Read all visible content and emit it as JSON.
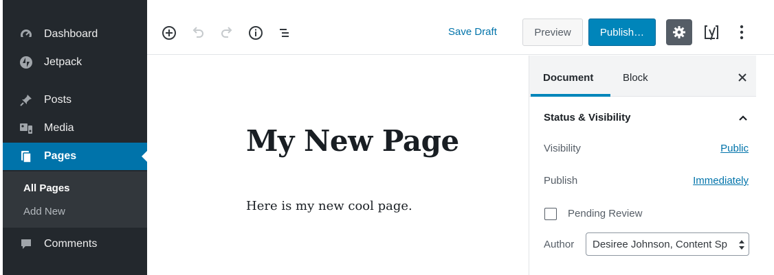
{
  "sidebar": {
    "items": [
      {
        "label": "Dashboard",
        "icon": "dashboard-icon"
      },
      {
        "label": "Jetpack",
        "icon": "jetpack-icon"
      },
      {
        "label": "Posts",
        "icon": "pin-icon"
      },
      {
        "label": "Media",
        "icon": "media-icon"
      },
      {
        "label": "Pages",
        "icon": "pages-icon",
        "active": true
      },
      {
        "label": "Comments",
        "icon": "comments-icon"
      }
    ],
    "submenu": [
      {
        "label": "All Pages",
        "current": true
      },
      {
        "label": "Add New"
      }
    ]
  },
  "toolbar": {
    "icons": [
      "add-block-icon",
      "undo-icon",
      "redo-icon",
      "info-icon",
      "outline-icon"
    ],
    "save_draft_label": "Save Draft",
    "preview_label": "Preview",
    "publish_label": "Publish…",
    "settings_icon": "gear-icon",
    "yoast_icon": "yoast-icon",
    "more_icon": "more-vertical-icon"
  },
  "editor": {
    "title": "My New Page",
    "paragraph": "Here is my new cool page."
  },
  "panel": {
    "tabs": [
      {
        "label": "Document",
        "active": true
      },
      {
        "label": "Block"
      }
    ],
    "close_icon": "close-icon",
    "section_title": "Status & Visibility",
    "visibility_label": "Visibility",
    "visibility_value": "Public",
    "publish_label": "Publish",
    "publish_value": "Immediately",
    "pending_review_label": "Pending Review",
    "pending_review_checked": false,
    "author_label": "Author",
    "author_value": "Desiree Johnson, Content Sp"
  },
  "colors": {
    "sidebar_bg": "#23282d",
    "submenu_bg": "#32373c",
    "accent": "#0073aa",
    "publish_button": "#0085ba",
    "settings_button": "#555d66"
  }
}
